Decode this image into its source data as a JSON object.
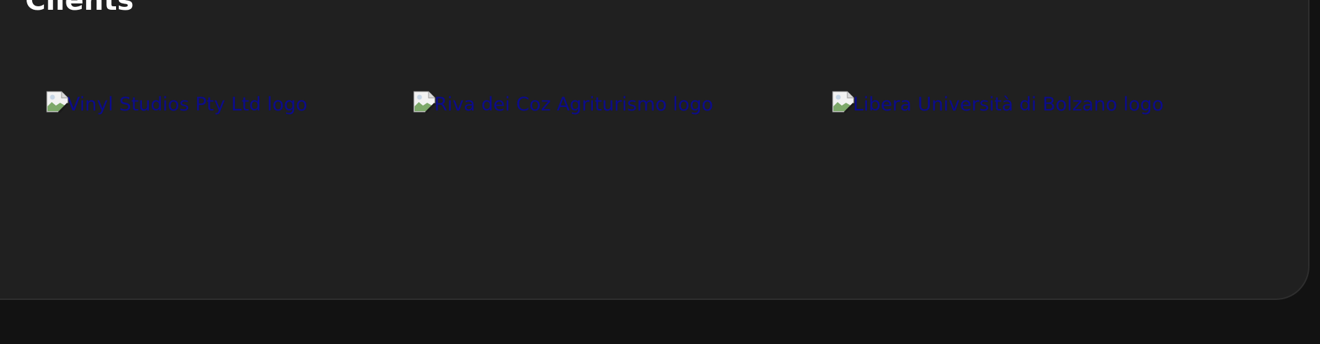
{
  "section": {
    "title": "Clients"
  },
  "clients": [
    {
      "alt": "Vinyl Studios Pty Ltd logo",
      "icon": "broken-image-icon"
    },
    {
      "alt": "Riva dei Coz Agriturismo logo",
      "icon": "broken-image-icon"
    },
    {
      "alt": "Libera Università di Bolzano logo",
      "icon": "broken-image-icon"
    }
  ],
  "colors": {
    "page_background": "#121212",
    "card_background": "#202020",
    "card_border": "#2e2e2e",
    "title_text": "#ffffff",
    "alt_text": "#0b0b8c"
  }
}
